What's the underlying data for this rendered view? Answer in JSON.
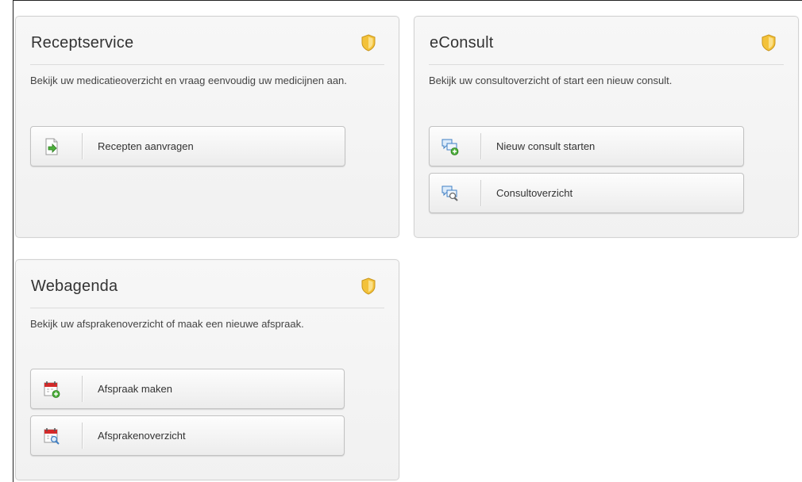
{
  "cards": {
    "receptservice": {
      "title": "Receptservice",
      "description": "Bekijk uw medicatieoverzicht en vraag eenvoudig uw medicijnen aan.",
      "buttons": [
        {
          "label": "Recepten aanvragen",
          "icon": "prescription-request-icon"
        }
      ]
    },
    "econsult": {
      "title": "eConsult",
      "description": "Bekijk uw consultoverzicht of start een nieuw consult.",
      "buttons": [
        {
          "label": "Nieuw consult starten",
          "icon": "chat-add-icon"
        },
        {
          "label": "Consultoverzicht",
          "icon": "chat-search-icon"
        }
      ]
    },
    "webagenda": {
      "title": "Webagenda",
      "description": "Bekijk uw afsprakenoverzicht of maak een nieuwe afspraak.",
      "buttons": [
        {
          "label": "Afspraak maken",
          "icon": "calendar-add-icon"
        },
        {
          "label": "Afsprakenoverzicht",
          "icon": "calendar-search-icon"
        }
      ]
    }
  },
  "colors": {
    "shield": "#f3c23a",
    "card_border": "#d2d2d2",
    "button_border": "#c2c2c2",
    "green_accent": "#4caf3a",
    "blue_accent": "#3f7fc4",
    "red_accent": "#d42a2a"
  }
}
